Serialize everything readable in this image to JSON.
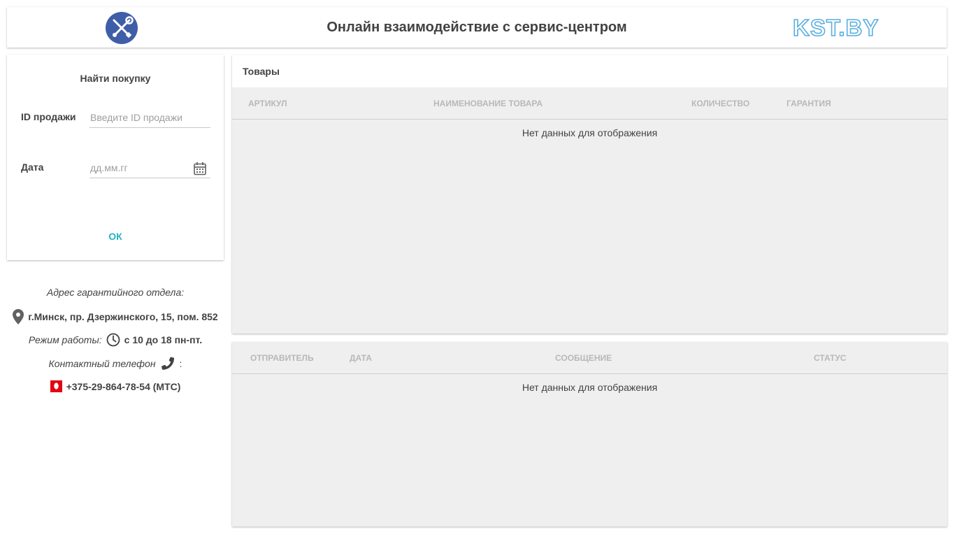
{
  "header": {
    "title": "Онлайн взаимодействие с сервис-центром",
    "brand": "KST.BY"
  },
  "search": {
    "title": "Найти покупку",
    "sale_id_label": "ID продажи",
    "sale_id_value": "",
    "sale_id_placeholder": "Введите ID продажи",
    "date_label": "Дата",
    "date_value": "",
    "date_placeholder": "дд.мм.гг",
    "ok_label": "ОК"
  },
  "info": {
    "address_title": "Адрес гарантийного отдела:",
    "address": "г.Минск, пр. Дзержинского, 15, пом. 852",
    "hours_label": "Режим работы:",
    "hours": "с 10 до 18 пн-пт.",
    "phone_label": "Контактный телефон",
    "phone_colon": ":",
    "phone": "+375-29-864-78-54 (МТС)"
  },
  "goods": {
    "title": "Товары",
    "columns": [
      "Артикул",
      "Наименование товара",
      "Количество",
      "Гарантия"
    ],
    "empty": "Нет данных для отображения"
  },
  "messages": {
    "columns": [
      "Отправитель",
      "Дата",
      "Сообщение",
      "Статус"
    ],
    "empty": "Нет данных для отображения"
  },
  "icons": {
    "logo": "wrench-screwdriver-icon",
    "calendar": "calendar-icon",
    "location": "map-pin-icon",
    "clock": "clock-icon",
    "phone": "phone-icon",
    "operator": "mts-logo-icon"
  },
  "colors": {
    "accent": "#26b3c4",
    "logo_blue": "#3f5ea8",
    "brand_blue": "#5aaee0",
    "mts_red": "#e30611"
  }
}
